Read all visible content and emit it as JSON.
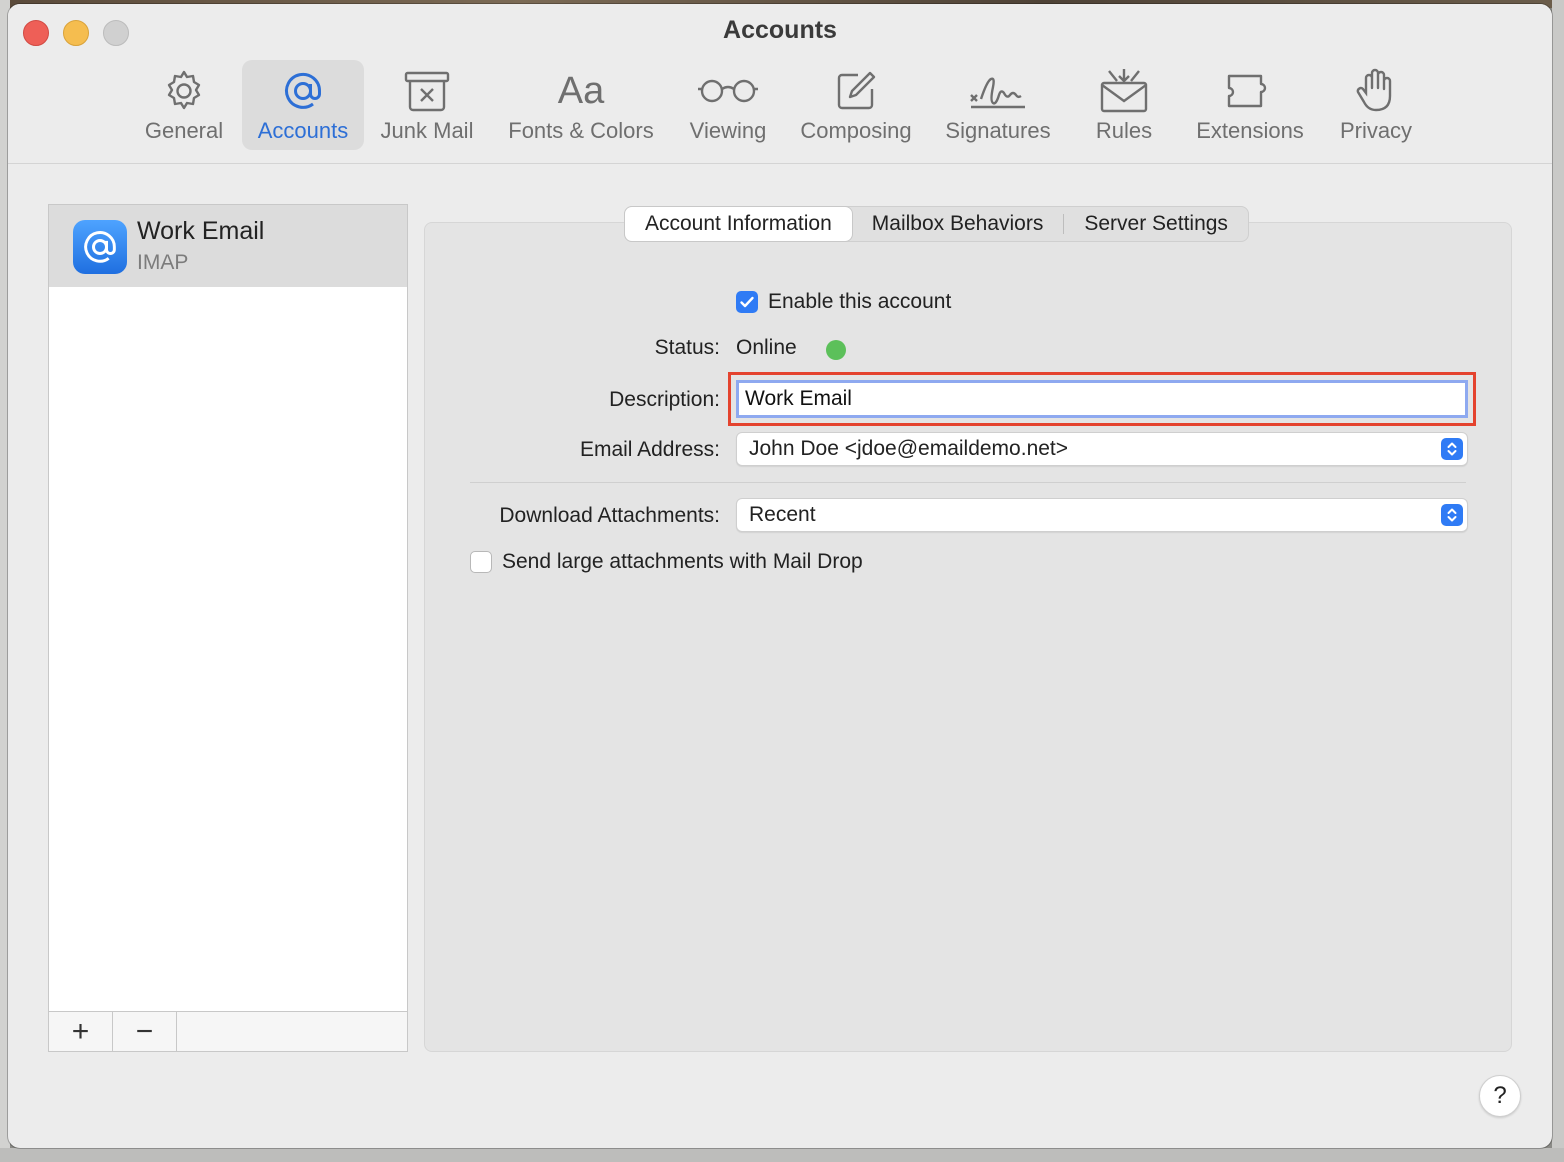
{
  "window": {
    "title": "Accounts"
  },
  "toolbar": {
    "items": [
      {
        "label": "General",
        "icon": "gear-icon"
      },
      {
        "label": "Accounts",
        "icon": "at-icon"
      },
      {
        "label": "Junk Mail",
        "icon": "junk-bin-icon"
      },
      {
        "label": "Fonts & Colors",
        "icon": "fonts-icon",
        "glyph": "Aa"
      },
      {
        "label": "Viewing",
        "icon": "glasses-icon"
      },
      {
        "label": "Composing",
        "icon": "compose-icon"
      },
      {
        "label": "Signatures",
        "icon": "signature-icon"
      },
      {
        "label": "Rules",
        "icon": "rules-icon"
      },
      {
        "label": "Extensions",
        "icon": "puzzle-icon"
      },
      {
        "label": "Privacy",
        "icon": "hand-icon"
      }
    ],
    "active": "Accounts"
  },
  "sidebar": {
    "accounts": [
      {
        "name": "Work Email",
        "type": "IMAP"
      }
    ],
    "add_label": "+",
    "remove_label": "−"
  },
  "tabs": [
    {
      "label": "Account Information",
      "active": true
    },
    {
      "label": "Mailbox Behaviors",
      "active": false
    },
    {
      "label": "Server Settings",
      "active": false
    }
  ],
  "form": {
    "enable_label": "Enable this account",
    "enable_checked": true,
    "status_label": "Status:",
    "status_value": "Online",
    "status_color": "#5cc05a",
    "description_label": "Description:",
    "description_value": "Work Email",
    "email_label": "Email Address:",
    "email_value": "John Doe <jdoe@emaildemo.net>",
    "download_label": "Download Attachments:",
    "download_value": "Recent",
    "maildrop_label": "Send large attachments with Mail Drop",
    "maildrop_checked": false
  },
  "help_label": "?",
  "colors": {
    "accent": "#2f7bf5",
    "highlight": "#e4432e"
  }
}
